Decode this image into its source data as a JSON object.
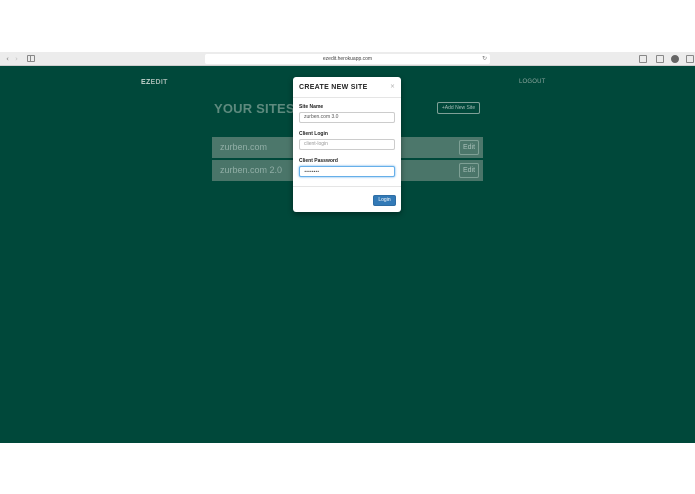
{
  "browser": {
    "url": "ezedit.herokuapp.com",
    "back_glyph": "‹",
    "forward_glyph": "›",
    "reload_glyph": "↻"
  },
  "app": {
    "logo_prefix": "EZ",
    "logo_suffix": "EDIT",
    "logout_label": "LOGOUT",
    "page_title": "YOUR SITES",
    "add_site_label": "+Add New Site",
    "sites": [
      {
        "name": "zurben.com",
        "edit_label": "Edit"
      },
      {
        "name": "zurben.com 2.0",
        "edit_label": "Edit"
      }
    ],
    "background_color": "#00483a"
  },
  "modal": {
    "title": "CREATE NEW SITE",
    "close_glyph": "×",
    "site_name_label": "Site Name",
    "site_name_value": "zurben.com 3.0",
    "client_login_label": "Client Login",
    "client_login_value": "client-login",
    "client_password_label": "Client Password",
    "client_password_value": "••••••••",
    "login_button_label": "Login",
    "button_color": "#337ab7"
  }
}
